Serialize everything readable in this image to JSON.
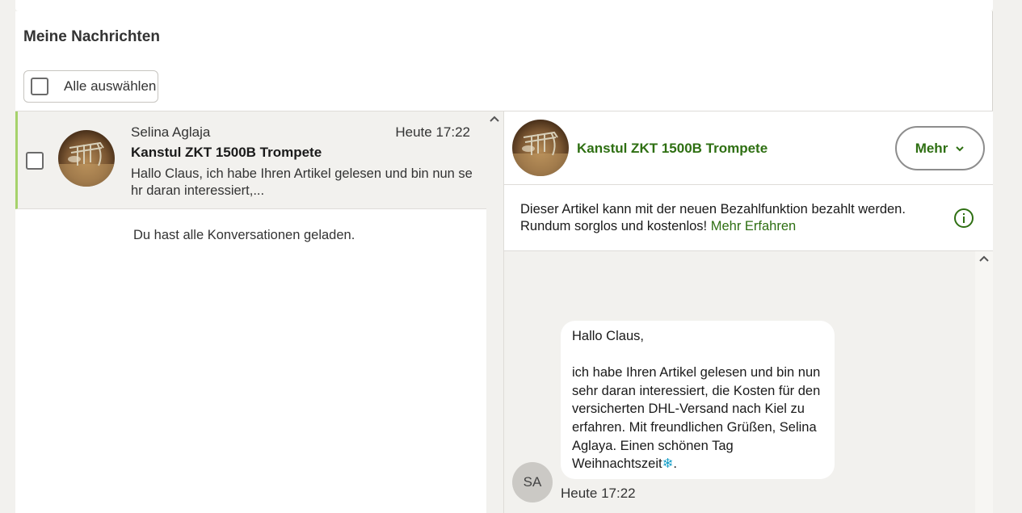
{
  "header": {
    "title": "Meine Nachrichten",
    "select_all_label": "Alle auswählen"
  },
  "conversations": [
    {
      "sender": "Selina Aglaja",
      "time": "Heute 17:22",
      "subject": "Kanstul ZKT 1500B Trompete",
      "preview": "Hallo Claus, ich habe Ihren Artikel gelesen und bin nun sehr daran interessiert,..."
    }
  ],
  "list_footer": "Du hast alle Konversationen geladen.",
  "detail": {
    "title": "Kanstul ZKT 1500B Trompete",
    "more_button": "Mehr",
    "info_text": "Dieser Artikel kann mit der neuen Bezahlfunktion bezahlt werden. Rundum sorglos und kostenlos!",
    "info_link": "Mehr Erfahren"
  },
  "message": {
    "greeting": "Hallo Claus,",
    "body": "ich habe Ihren Artikel gelesen und bin nun sehr daran interessiert, die Kosten für den versicherten DHL-Versand nach Kiel zu erfahren. Mit freundlichen Grüßen, Selina Aglaya. Einen schönen Tag Weihnachtszeit",
    "emoji": "❄",
    "ending": ".",
    "sender_initials": "SA",
    "time": "Heute 17:22"
  },
  "colors": {
    "accent_green": "#2e6f12",
    "selection_bar": "#a6d26b",
    "background": "#f2f1ee"
  },
  "icons": {
    "more_chevron": "chevron-down-icon",
    "info": "info-icon",
    "scroll": "chevron-up-icon"
  }
}
